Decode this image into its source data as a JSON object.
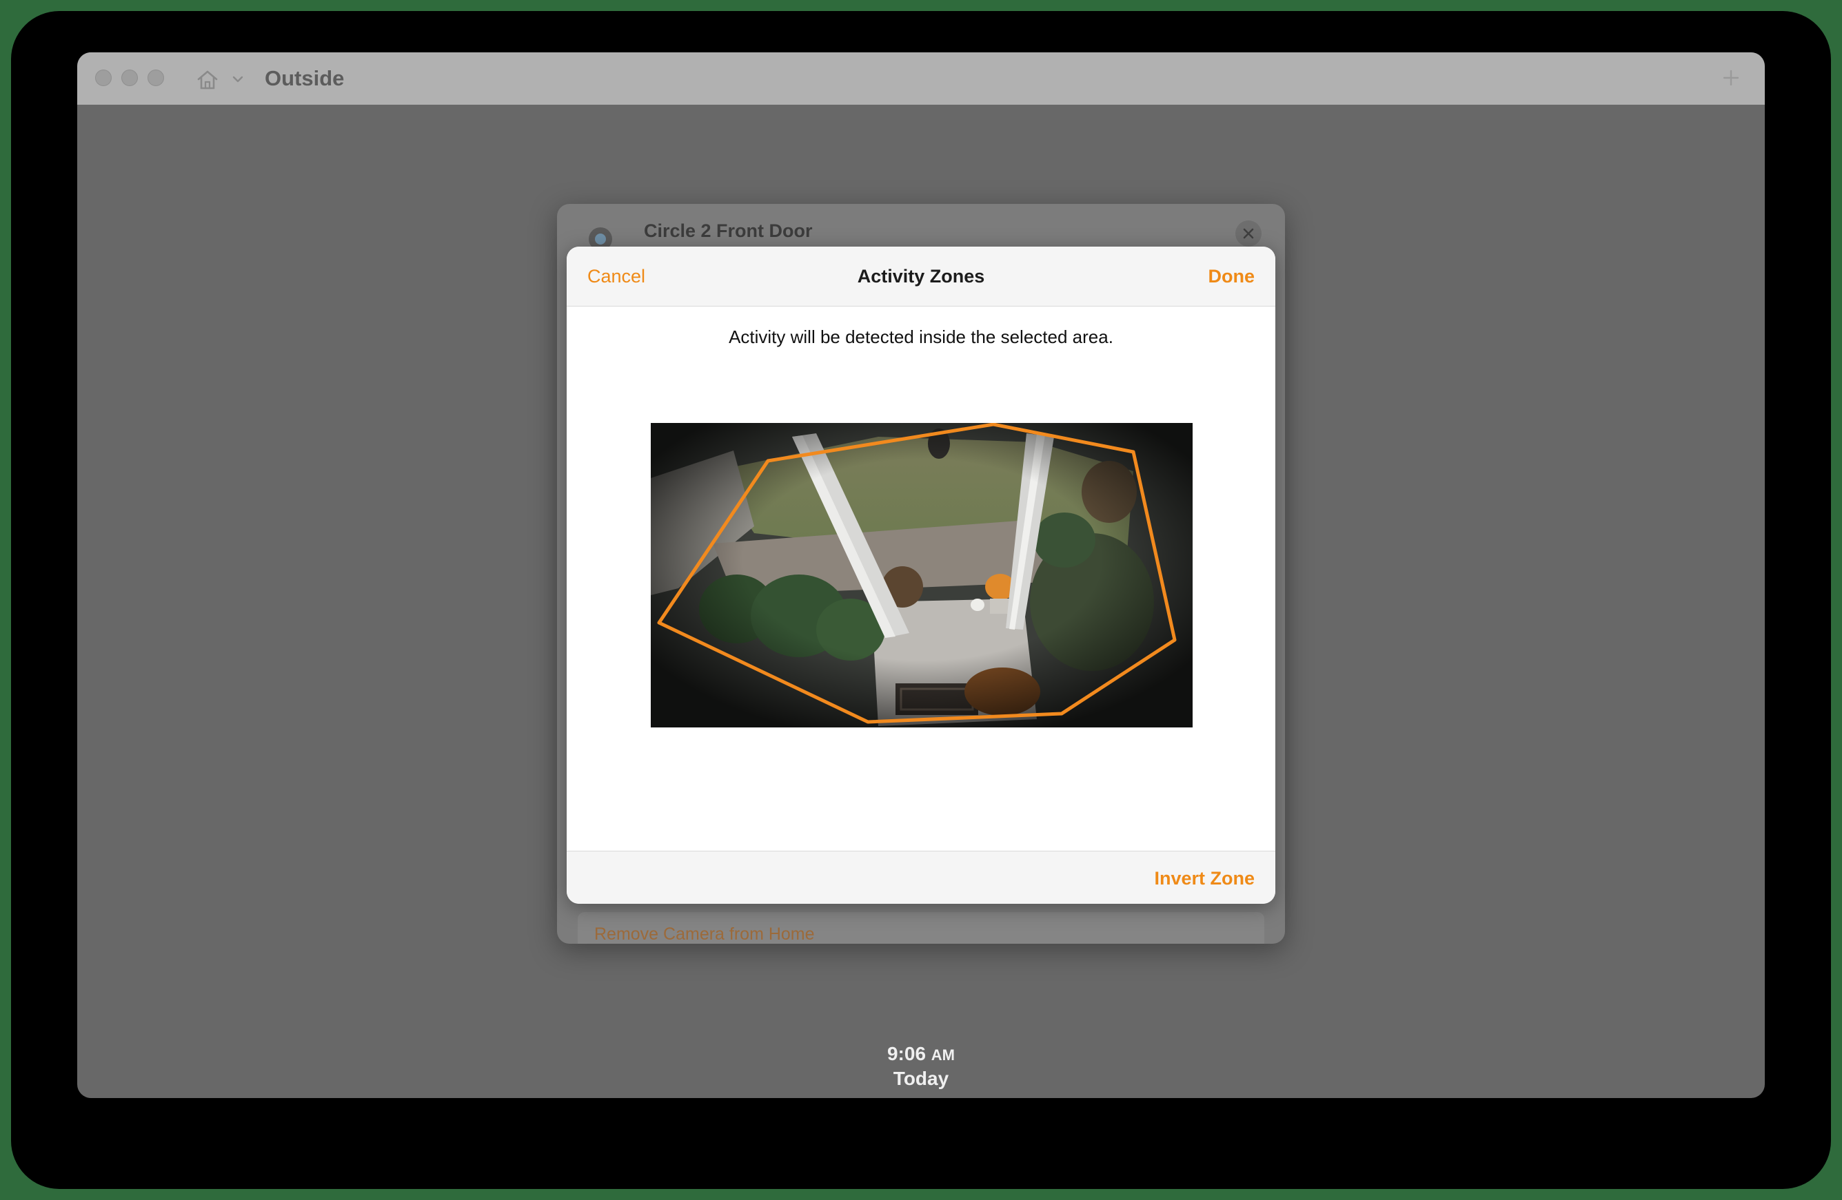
{
  "window": {
    "title": "Outside"
  },
  "background_sheet": {
    "camera_name": "Circle 2 Front Door",
    "remove_label": "Remove Camera from Home"
  },
  "modal": {
    "cancel_label": "Cancel",
    "title": "Activity Zones",
    "done_label": "Done",
    "instructions": "Activity will be detected inside the selected area.",
    "invert_label": "Invert Zone"
  },
  "timestamp": {
    "time": "9:06",
    "ampm": "AM",
    "day": "Today"
  },
  "colors": {
    "accent": "#ef8a17",
    "zone_outline": "#f28a1e"
  },
  "icons": {
    "home": "home-icon",
    "chevron": "chevron-down-icon",
    "add": "plus-icon",
    "close": "close-icon",
    "camera": "camera-icon"
  }
}
